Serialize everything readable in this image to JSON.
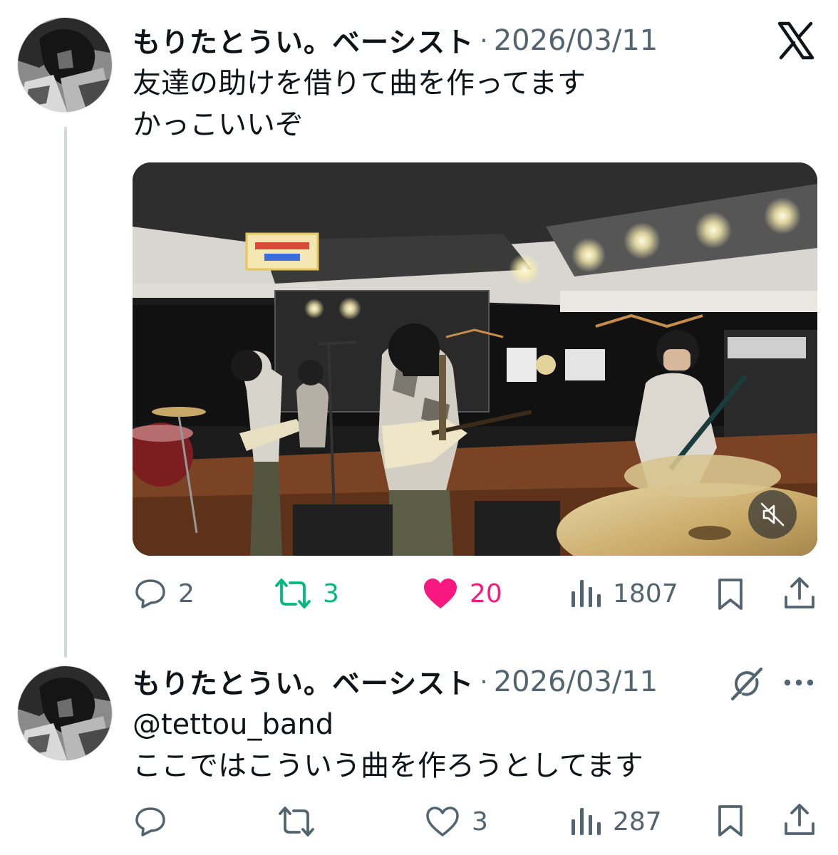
{
  "tweets": [
    {
      "author": "もりたとうい。ベーシスト",
      "separator": "·",
      "date": "2026/03/11",
      "lines": [
        "友達の助けを借りて曲を作ってます",
        "かっこいいぞ"
      ],
      "actions": {
        "replies": "2",
        "reposts": "3",
        "likes": "20",
        "views": "1807"
      },
      "liked": true,
      "media": {
        "type": "video",
        "muted": true
      }
    },
    {
      "author": "もりたとうい。ベーシスト",
      "separator": "·",
      "date": "2026/03/11",
      "mention": "@tettou_band",
      "lines": [
        "ここではこういう曲を作ろうとしてます"
      ],
      "actions": {
        "replies": "",
        "reposts": "",
        "likes": "3",
        "views": "287"
      },
      "liked": false
    }
  ],
  "icons": {
    "brand": "x-logo-icon",
    "reply": "speech-bubble-icon",
    "repost": "repost-arrows-icon",
    "like": "heart-icon",
    "views": "bar-chart-icon",
    "bookmark": "bookmark-icon",
    "share": "share-upload-icon",
    "grok": "grok-slash-circle-icon",
    "more": "more-dots-icon",
    "mute": "speaker-muted-icon"
  },
  "colors": {
    "text": "#0f1419",
    "secondary": "#536471",
    "repost_active": "#00ba7c",
    "like_active": "#f91880",
    "thread_line": "#cfd9de"
  }
}
